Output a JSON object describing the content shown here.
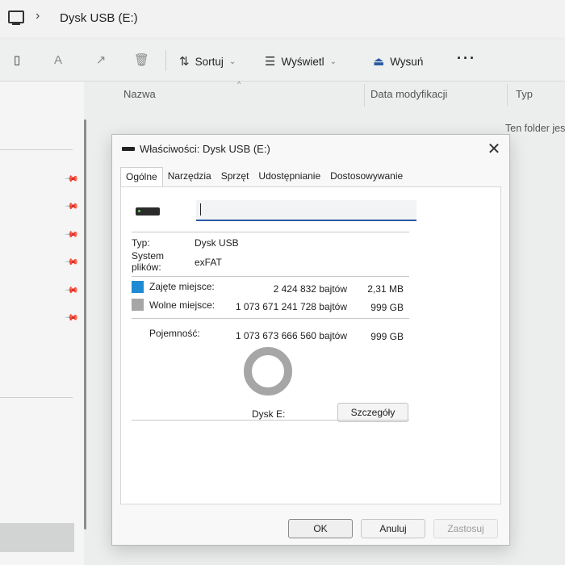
{
  "explorer": {
    "breadcrumb": "Dysk USB (E:)",
    "toolbar": {
      "sort_label": "Sortuj",
      "view_label": "Wyświetl",
      "eject_label": "Wysuń"
    },
    "columns": [
      "Nazwa",
      "Data modyfikacji",
      "Typ"
    ],
    "empty_message": "Ten folder jes"
  },
  "dialog": {
    "title": "Właściwości: Dysk USB (E:)",
    "tabs": [
      "Ogólne",
      "Narzędzia",
      "Sprzęt",
      "Udostępnianie",
      "Dostosowywanie"
    ],
    "active_tab": "Ogólne",
    "name_value": "",
    "type_label": "Typ:",
    "type_value": "Dysk USB",
    "fs_label_1": "System",
    "fs_label_2": "plików:",
    "fs_value": "exFAT",
    "used_label": "Zajęte miejsce:",
    "used_bytes": "2 424 832 bajtów",
    "used_size": "2,31 MB",
    "free_label": "Wolne miejsce:",
    "free_bytes": "1 073 671 241 728 bajtów",
    "free_size": "999 GB",
    "capacity_label": "Pojemność:",
    "capacity_bytes": "1 073 673 666 560 bajtów",
    "capacity_size": "999 GB",
    "drive_label": "Dysk E:",
    "details_button": "Szczegóły",
    "ok_button": "OK",
    "cancel_button": "Anuluj",
    "apply_button": "Zastosuj",
    "used_color": "#1e8ad4",
    "free_color": "#a6a6a6",
    "used_fraction": 2.3e-06
  }
}
